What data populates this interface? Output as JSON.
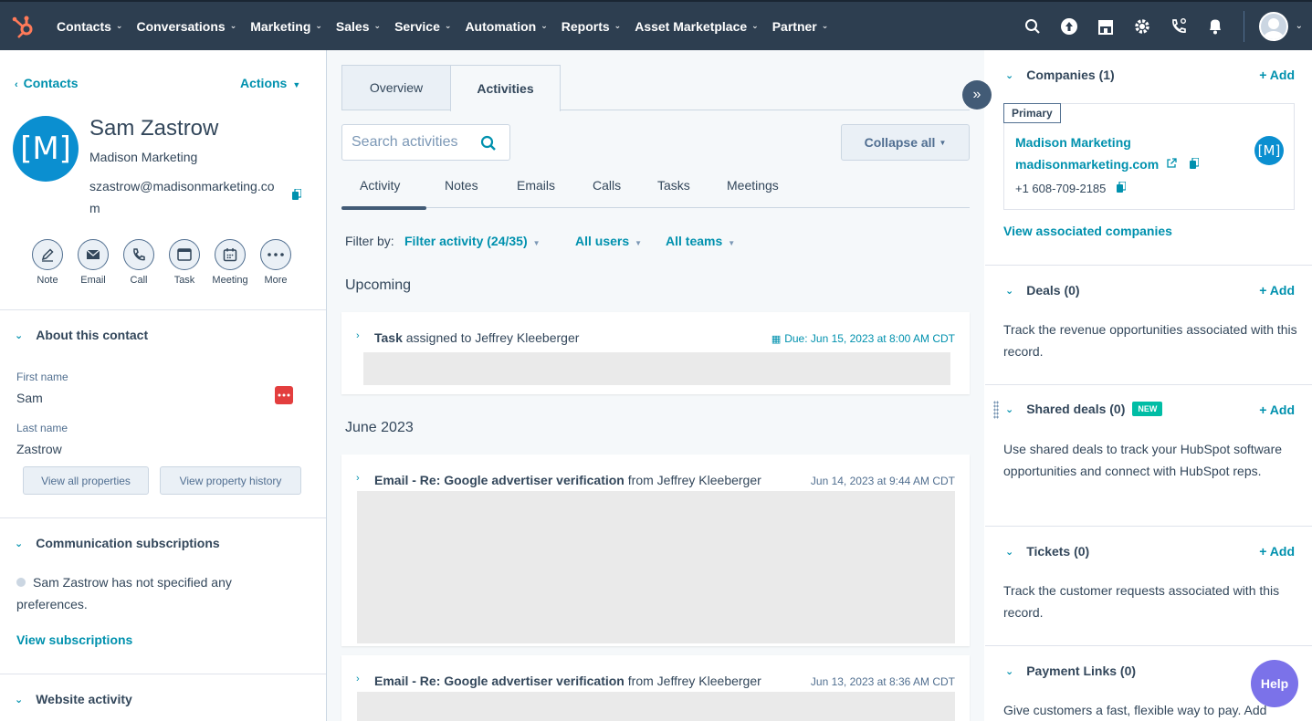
{
  "nav": {
    "items": [
      "Contacts",
      "Conversations",
      "Marketing",
      "Sales",
      "Service",
      "Automation",
      "Reports",
      "Asset Marketplace",
      "Partner"
    ]
  },
  "left": {
    "back_label": "Contacts",
    "actions_label": "Actions",
    "avatar_initials": "[M]",
    "name": "Sam Zastrow",
    "company": "Madison Marketing",
    "email": "szastrow@madisonmarketing.com",
    "quick_actions": [
      "Note",
      "Email",
      "Call",
      "Task",
      "Meeting",
      "More"
    ],
    "about_title": "About this contact",
    "first_name_label": "First name",
    "first_name": "Sam",
    "last_name_label": "Last name",
    "last_name": "Zastrow",
    "view_all_properties": "View all properties",
    "view_property_history": "View property history",
    "comm_title": "Communication subscriptions",
    "comm_text": "Sam Zastrow has not specified any preferences.",
    "view_subscriptions": "View subscriptions",
    "website_title": "Website activity"
  },
  "mid": {
    "tabs": [
      "Overview",
      "Activities"
    ],
    "search_placeholder": "Search activities",
    "collapse_all": "Collapse all",
    "subtabs": [
      "Activity",
      "Notes",
      "Emails",
      "Calls",
      "Tasks",
      "Meetings"
    ],
    "filter_by": "Filter by:",
    "filter_activity": "Filter activity (24/35)",
    "all_users": "All users",
    "all_teams": "All teams",
    "upcoming": "Upcoming",
    "task_bold": "Task",
    "task_rest": "assigned to Jeffrey Kleeberger",
    "task_due": "Due: Jun 15, 2023 at 8:00 AM CDT",
    "month": "June 2023",
    "email1_bold": "Email - Re: Google advertiser verification",
    "email1_rest": "from Jeffrey Kleeberger",
    "email1_date": "Jun 14, 2023 at 9:44 AM CDT",
    "email2_bold": "Email - Re: Google advertiser verification",
    "email2_rest": "from Jeffrey Kleeberger",
    "email2_date": "Jun 13, 2023 at 8:36 AM CDT"
  },
  "right": {
    "add_label": "+ Add",
    "companies_title": "Companies (1)",
    "primary_badge": "Primary",
    "company_name": "Madison Marketing",
    "company_domain": "madisonmarketing.com",
    "company_phone": "+1 608-709-2185",
    "view_associated": "View associated companies",
    "deals_title": "Deals (0)",
    "deals_text": "Track the revenue opportunities associated with this record.",
    "shared_title": "Shared deals (0)",
    "new_badge": "NEW",
    "shared_text": "Use shared deals to track your HubSpot software opportunities and connect with HubSpot reps.",
    "tickets_title": "Tickets (0)",
    "tickets_text": "Track the customer requests associated with this record.",
    "payment_title": "Payment Links (0)",
    "payment_text": "Give customers a fast, flexible way to pay. Add"
  },
  "help_label": "Help",
  "colors": {
    "nav_bg": "#2d3e50",
    "accent": "#0091ae",
    "logo": "#ff7a59",
    "avatar": "#0b8fd0",
    "help": "#7b72e9"
  }
}
